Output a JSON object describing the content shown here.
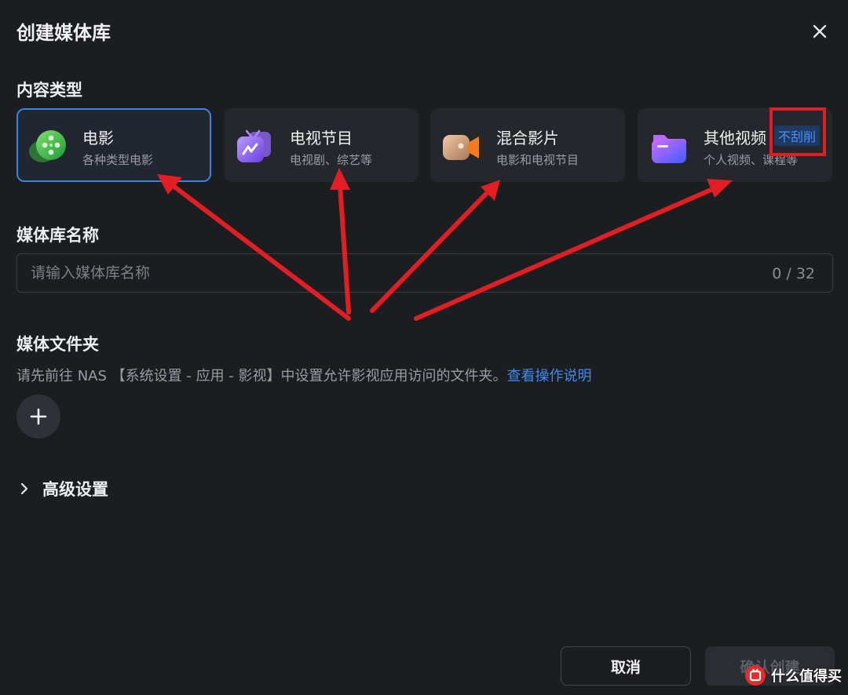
{
  "dialog": {
    "title": "创建媒体库",
    "close_icon": "close-icon"
  },
  "content_type": {
    "label": "内容类型",
    "cards": [
      {
        "name": "电影",
        "desc": "各种类型电影",
        "icon": "movie-reel-icon",
        "selected": true
      },
      {
        "name": "电视节目",
        "desc": "电视剧、综艺等",
        "icon": "tv-icon",
        "selected": false
      },
      {
        "name": "混合影片",
        "desc": "电影和电视节目",
        "icon": "video-camera-icon",
        "selected": false
      },
      {
        "name": "其他视频",
        "desc": "个人视频、课程等",
        "icon": "folder-icon",
        "tag": "不刮削",
        "selected": false
      }
    ]
  },
  "library_name": {
    "label": "媒体库名称",
    "placeholder": "请输入媒体库名称",
    "counter": "0 / 32"
  },
  "media_folder": {
    "label": "媒体文件夹",
    "hint": "请先前往 NAS 【系统设置 - 应用 - 影视】中设置允许影视应用访问的文件夹。",
    "link": "查看操作说明",
    "add_icon": "plus-icon"
  },
  "advanced": {
    "label": "高级设置",
    "icon": "chevron-right-icon"
  },
  "footer": {
    "cancel_label": "取消",
    "confirm_label": "确认创建"
  },
  "watermark": {
    "text": "什么值得买",
    "icon": "smzdm-logo-icon"
  },
  "colors": {
    "background": "#1c1d21",
    "card": "#25272d",
    "selected_border": "#3b82e6",
    "link": "#3e8bf0",
    "tag": "#4a90ff",
    "annotation_red": "#e01e23"
  }
}
